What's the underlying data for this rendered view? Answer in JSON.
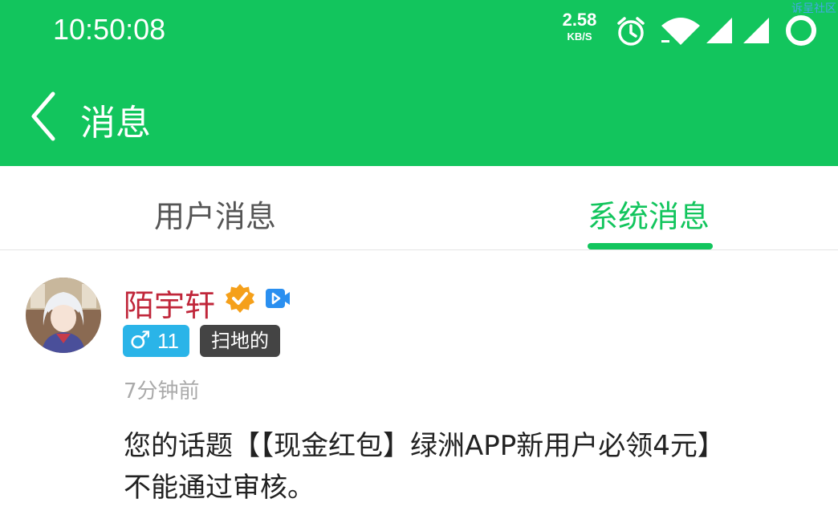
{
  "status_bar": {
    "time": "10:50:08",
    "net_speed": "2.58",
    "net_unit": "KB/S",
    "icons": [
      "alarm-icon",
      "wifi-icon",
      "signal-icon",
      "signal-icon",
      "battery-ring-icon"
    ],
    "watermark": "诉呈社区"
  },
  "header": {
    "title": "消息",
    "background_color": "#12c55d"
  },
  "tabs": [
    {
      "label": "用户消息",
      "active": false
    },
    {
      "label": "系统消息",
      "active": true
    }
  ],
  "message": {
    "user_name": "陌宇轩",
    "gender_symbol": "♂",
    "age": "11",
    "role": "扫地的",
    "time_ago": "7分钟前",
    "line1": "您的话题【【现金红包】绿洲APP新用户必领4元】",
    "line2": "不能通过审核。"
  },
  "colors": {
    "accent": "#12c55d",
    "username": "#c0263a",
    "gender_badge": "#2ab4e8",
    "role_badge": "#444444"
  }
}
